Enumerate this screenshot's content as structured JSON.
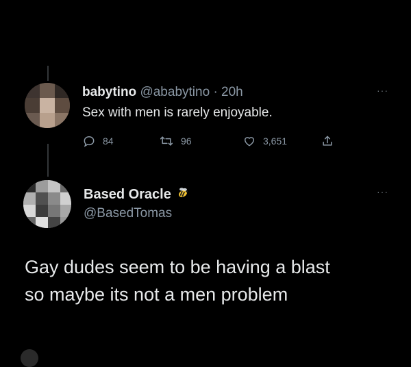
{
  "tweet1": {
    "display_name": "babytino",
    "handle": "@ababytino",
    "separator": "·",
    "time": "20h",
    "text": "Sex with men is rarely enjoyable.",
    "reply_count": "84",
    "retweet_count": "96",
    "like_count": "3,651",
    "more_label": "···"
  },
  "tweet2": {
    "display_name": "Based Oracle",
    "handle": "@BasedTomas",
    "text_line1": "Gay dudes seem to be having a blast",
    "text_line2": "so maybe its not a men problem",
    "more_label": "···"
  },
  "icons": {
    "reply": "reply-icon",
    "retweet": "retweet-icon",
    "like": "heart-icon",
    "share": "share-icon",
    "badge": "bee-emoji"
  },
  "colors": {
    "background": "#000000",
    "text": "#e7e9ea",
    "muted": "#8b98a5",
    "thread_line": "#333639"
  }
}
